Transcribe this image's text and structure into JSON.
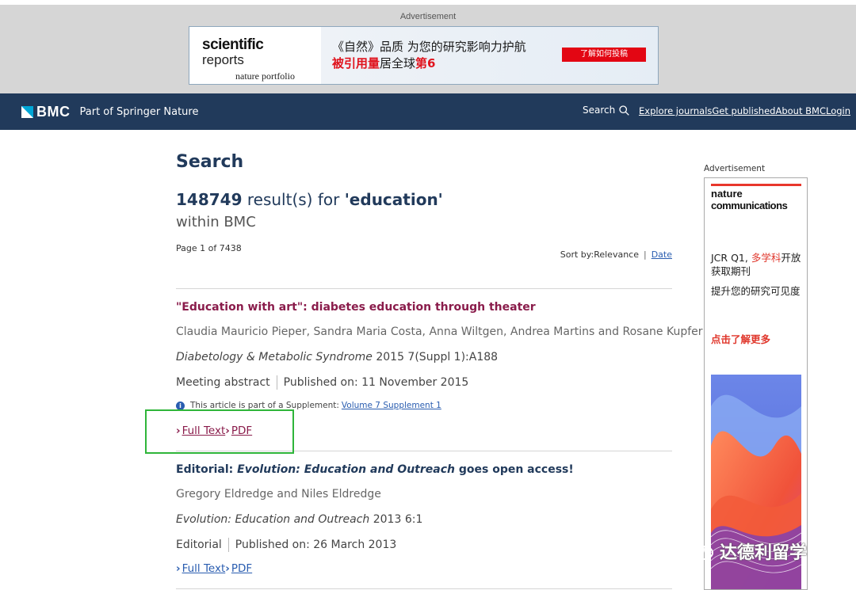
{
  "ad_top": {
    "label": "Advertisement",
    "brand_line1": "scientific",
    "brand_line2": "reports",
    "brand_line3": "nature portfolio",
    "headline1": "《自然》品质 为您的研究影响力护航",
    "headline2_red1": "被引用量",
    "headline2_mid": "居全球",
    "headline2_red2": "第6",
    "cta": "了解如何投稿"
  },
  "header": {
    "logo": "BMC",
    "tagline": "Part of Springer Nature",
    "search_label": "Search",
    "nav": [
      "Explore journals",
      "Get published",
      "About BMC",
      "Login"
    ],
    "colors": {
      "bg": "#213a5b",
      "logo_accent": "#00a6d6"
    }
  },
  "search": {
    "heading": "Search",
    "count": "148749",
    "count_suffix": " result(s) for ",
    "query": "'education'",
    "within": "within BMC",
    "page_info": "Page 1 of 7438",
    "sort_label": "Sort by:",
    "sort_current": "Relevance",
    "sort_alt": "Date"
  },
  "results": [
    {
      "title": "\"Education with art\": diabetes education through theater",
      "authors": "Claudia Mauricio Pieper, Sandra Maria Costa, Anna Wiltgen, Andrea Martins and Rosane Kupfer",
      "journal": "Diabetology & Metabolic Syndrome",
      "citation": " 2015 7(Suppl 1):A188",
      "type": "Meeting abstract",
      "published": "Published on: 11 November 2015",
      "supplement_text": "This article is part of a Supplement:",
      "supplement_link": "Volume 7 Supplement 1",
      "link_fulltext": "Full Text",
      "link_pdf": "PDF"
    },
    {
      "title_prefix": "Editorial: ",
      "title_italic": "Evolution: Education and Outreach",
      "title_suffix": " goes open access!",
      "authors": "Gregory Eldredge and Niles Eldredge",
      "journal": "Evolution: Education and Outreach",
      "citation": " 2013 6:1",
      "type": "Editorial",
      "published": "Published on: 26 March 2013",
      "link_fulltext": "Full Text",
      "link_pdf": "PDF"
    }
  ],
  "ad_side": {
    "label": "Advertisement",
    "brand1": "nature",
    "brand2": "communications",
    "text1_a": "JCR Q1, ",
    "text1_red": "多学科",
    "text1_b": "开放获取期刊",
    "text2": "提升您的研究可见度",
    "cta": "点击了解更多"
  },
  "watermark": "达德利留学"
}
